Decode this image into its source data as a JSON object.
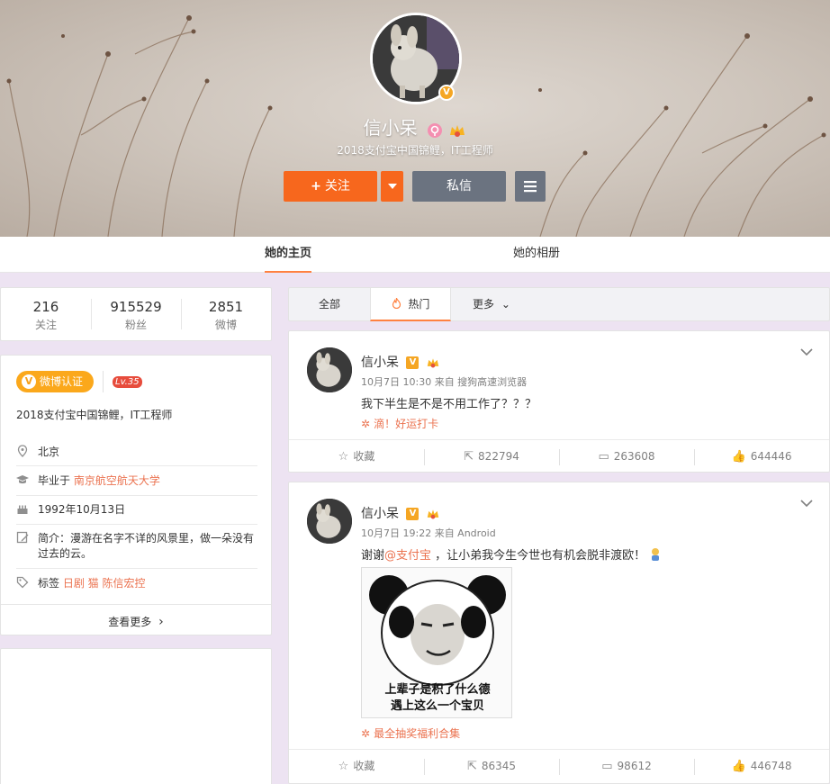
{
  "profile": {
    "name": "信小呆",
    "description": "2018支付宝中国锦鲤，IT工程师",
    "follow_label": "关注",
    "follow_plus": "+",
    "follow_dropdown_icon": "caret-down-icon",
    "message_label": "私信",
    "menu_icon": "menu-icon",
    "verify_badge": "V"
  },
  "tabs": [
    {
      "label": "她的主页",
      "active": true
    },
    {
      "label": "她的相册",
      "active": false
    }
  ],
  "stats": [
    {
      "value": "216",
      "label": "关注"
    },
    {
      "value": "915529",
      "label": "粉丝"
    },
    {
      "value": "2851",
      "label": "微博"
    }
  ],
  "info": {
    "verify_tag": "微博认证",
    "verify_v": "V",
    "level": "Lv.35",
    "verify_desc": "2018支付宝中国锦鲤，IT工程师",
    "location": "北京",
    "school_prefix": "毕业于",
    "school": "南京航空航天大学",
    "birthday": "1992年10月13日",
    "intro": "简介：漫游在名字不详的风景里，做一朵没有过去的云。",
    "tags_label": "标签",
    "tags": "日剧 猫 陈信宏控",
    "more": "查看更多",
    "more_arrow": "›"
  },
  "filter": {
    "all": "全部",
    "hot": "热门",
    "more": "更多",
    "more_arrow": "⌄"
  },
  "posts": [
    {
      "author": "信小呆",
      "meta": "10月7日 10:30 来自 搜狗高速浏览器",
      "text": "我下半生是不是不用工作了？？？",
      "promo": "滴！好运打卡",
      "collect": "收藏",
      "reposts": "822794",
      "comments": "263608",
      "likes": "644446"
    },
    {
      "author": "信小呆",
      "meta": "10月7日 19:22 来自 Android",
      "text_prefix": "谢谢",
      "mention": "@支付宝",
      "text_suffix": " ，让小弟我今生今世也有机会脱非渡欧！",
      "meme_line1": "上辈子是积了什么德",
      "meme_line2": "遇上这么一个宝贝",
      "promo": "最全抽奖福利合集",
      "collect": "收藏",
      "reposts": "86345",
      "comments": "98612",
      "likes": "446748"
    }
  ],
  "colors": {
    "accent": "#f7671d",
    "link": "#eb7350",
    "gold": "#f5a623",
    "gray_button": "#6b7380",
    "background": "#ede3f2"
  }
}
